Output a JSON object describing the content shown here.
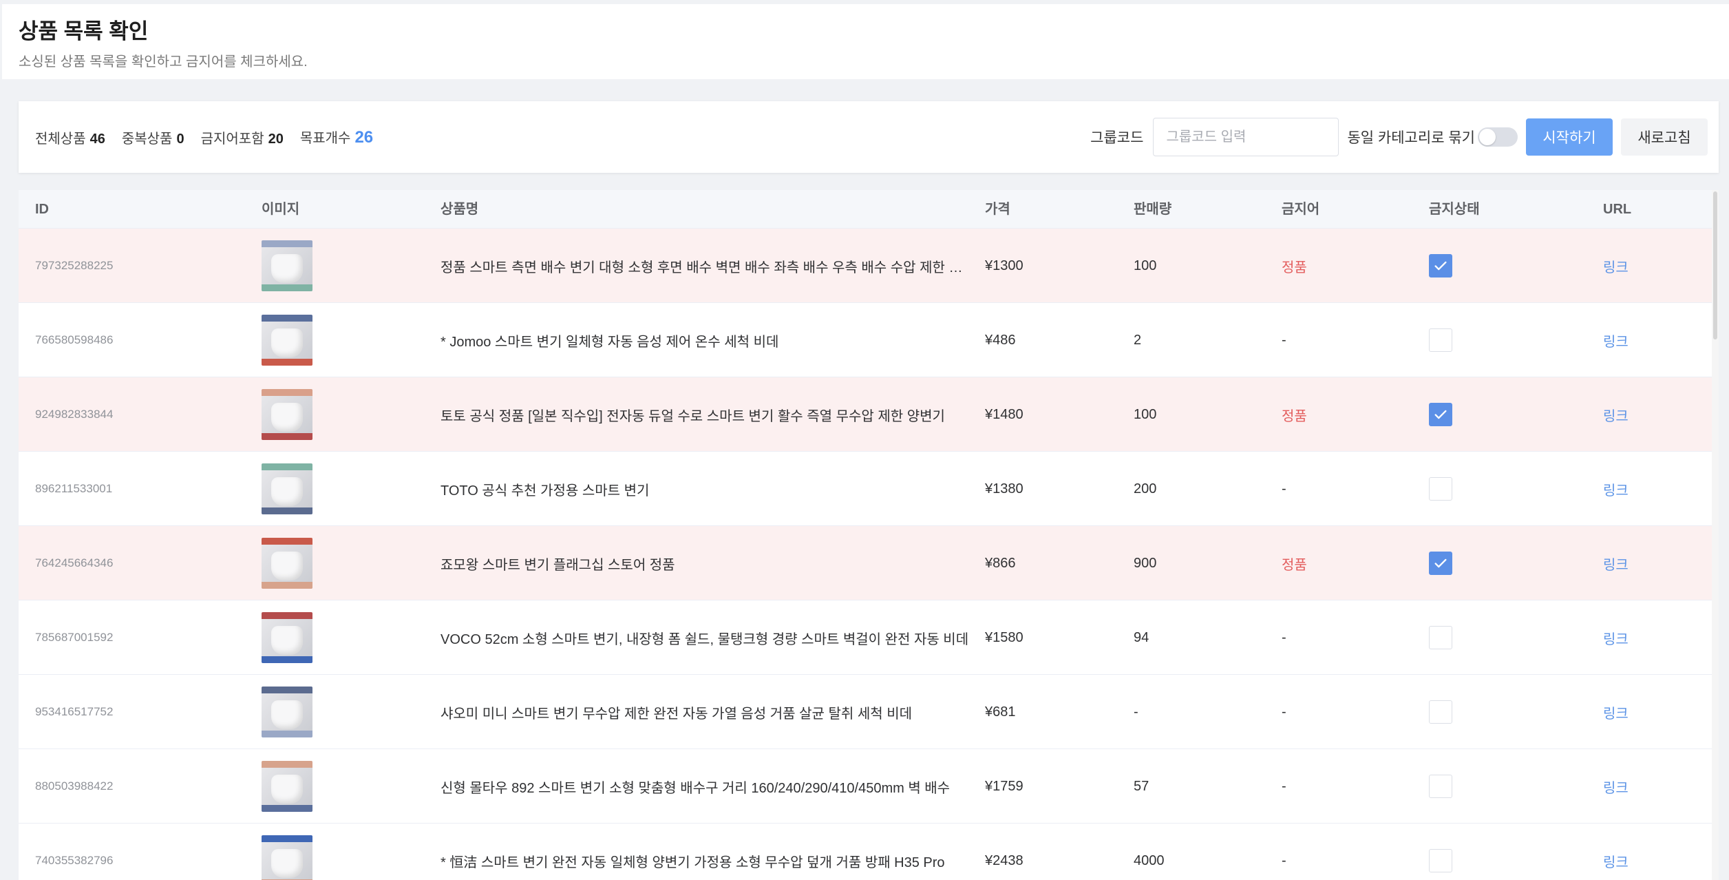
{
  "header": {
    "title": "상품 목록 확인",
    "subtitle": "소싱된 상품 목록을 확인하고 금지어를 체크하세요."
  },
  "stats": [
    {
      "label": "전체상품",
      "value": "46"
    },
    {
      "label": "중복상품",
      "value": "0"
    },
    {
      "label": "금지어포함",
      "value": "20"
    },
    {
      "label": "목표개수",
      "value": "26"
    }
  ],
  "controls": {
    "group_code_label": "그룹코드",
    "group_code_placeholder": "그룹코드 입력",
    "group_code_value": "",
    "same_category_label": "동일 카테고리로 묶기",
    "same_category_on": false,
    "start_label": "시작하기",
    "refresh_label": "새로고침"
  },
  "colors": {
    "accent": "#69a3f5",
    "flagged_row": "#fcf0f0",
    "banned_text": "#e35d5d",
    "link": "#5b93e6"
  },
  "table": {
    "columns": [
      "ID",
      "이미지",
      "상품명",
      "가격",
      "판매량",
      "금지어",
      "금지상태",
      "URL"
    ],
    "rows": [
      {
        "id": "797325288225",
        "name": "정품 스마트 측면 배수 변기 대형 소형 후면 배수 벽면 배수 좌측 배수 우측 배수 수압 제한 없음",
        "price": "¥1300",
        "sales": "100",
        "banned_word": "정품",
        "banned": true,
        "url_label": "링크"
      },
      {
        "id": "766580598486",
        "name": "* Jomoo 스마트 변기 일체형 자동 음성 제어 온수 세척 비데",
        "price": "¥486",
        "sales": "2",
        "banned_word": "-",
        "banned": false,
        "url_label": "링크"
      },
      {
        "id": "924982833844",
        "name": "토토 공식 정품 [일본 직수입] 전자동 듀얼 수로 스마트 변기 활수 즉열 무수압 제한 양변기",
        "price": "¥1480",
        "sales": "100",
        "banned_word": "정품",
        "banned": true,
        "url_label": "링크"
      },
      {
        "id": "896211533001",
        "name": "TOTO 공식 추천 가정용 스마트 변기",
        "price": "¥1380",
        "sales": "200",
        "banned_word": "-",
        "banned": false,
        "url_label": "링크"
      },
      {
        "id": "764245664346",
        "name": "죠모왕 스마트 변기 플래그십 스토어 정품",
        "price": "¥866",
        "sales": "900",
        "banned_word": "정품",
        "banned": true,
        "url_label": "링크"
      },
      {
        "id": "785687001592",
        "name": "VOCO 52cm 소형 스마트 변기, 내장형 폼 쉴드, 물탱크형 경량 스마트 벽걸이 완전 자동 비데",
        "price": "¥1580",
        "sales": "94",
        "banned_word": "-",
        "banned": false,
        "url_label": "링크"
      },
      {
        "id": "953416517752",
        "name": "샤오미 미니 스마트 변기 무수압 제한 완전 자동 가열 음성 거품 살균 탈취 세척 비데",
        "price": "¥681",
        "sales": "-",
        "banned_word": "-",
        "banned": false,
        "url_label": "링크"
      },
      {
        "id": "880503988422",
        "name": "신형 몰타우 892 스마트 변기 소형 맞춤형 배수구 거리 160/240/290/410/450mm 벽 배수",
        "price": "¥1759",
        "sales": "57",
        "banned_word": "-",
        "banned": false,
        "url_label": "링크"
      },
      {
        "id": "740355382796",
        "name": "* 恒洁 스마트 변기 완전 자동 일체형 양변기 가정용 소형 무수압 덮개 거품 방패 H35 Pro",
        "price": "¥2438",
        "sales": "4000",
        "banned_word": "-",
        "banned": false,
        "url_label": "링크"
      }
    ]
  }
}
